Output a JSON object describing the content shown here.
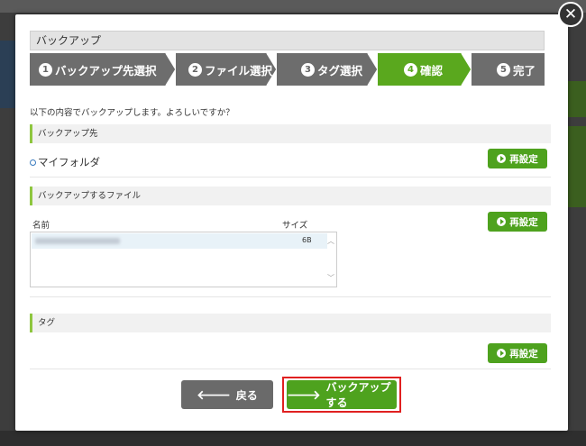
{
  "dialog": {
    "title": "バックアップ",
    "close_glyph": "✕"
  },
  "steps": [
    {
      "num": "1",
      "label": "バックアップ先選択",
      "active": false
    },
    {
      "num": "2",
      "label": "ファイル選択",
      "active": false
    },
    {
      "num": "3",
      "label": "タグ選択",
      "active": false
    },
    {
      "num": "4",
      "label": "確認",
      "active": true
    },
    {
      "num": "5",
      "label": "完了",
      "active": false
    }
  ],
  "message": "以下の内容でバックアップします。よろしいですか？",
  "destination": {
    "header": "バックアップ先",
    "folder": "マイフォルダ",
    "reset_label": "再設定"
  },
  "files": {
    "header": "バックアップするファイル",
    "col_name": "名前",
    "col_size": "サイズ",
    "rows": [
      {
        "size": "6B"
      }
    ],
    "reset_label": "再設定"
  },
  "tags": {
    "header": "タグ",
    "reset_label": "再設定"
  },
  "footer": {
    "back_label": "戻る",
    "backup_label": "バックアップする"
  },
  "colors": {
    "accent_green": "#4ea21e",
    "step_gray": "#6d6d6d",
    "highlight_red": "#e02020"
  }
}
